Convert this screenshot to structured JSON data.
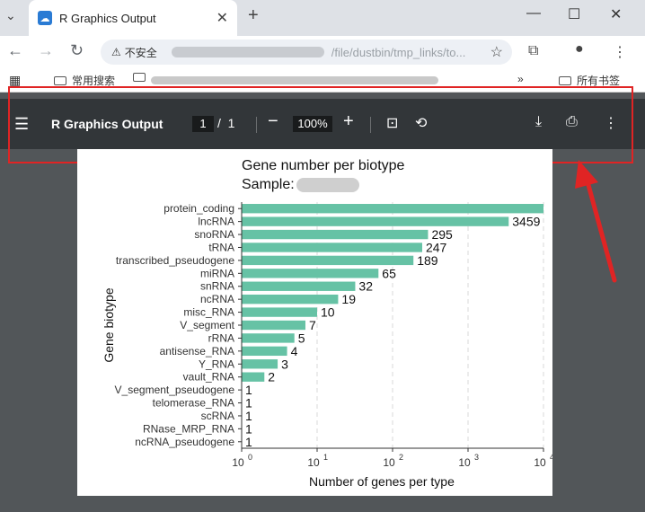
{
  "browser": {
    "tab_title": "R Graphics Output",
    "tab_close": "✕",
    "new_tab": "+",
    "tab_dropdown": "⌄",
    "minimize": "—",
    "maximize": "☐",
    "close": "✕",
    "insecure_label": "不安全",
    "url_visible": "/file/dustbin/tmp_links/to...",
    "bookmarks": [
      "常用搜索",
      "所有书签"
    ],
    "bookmarks_more": "»"
  },
  "pdf_toolbar": {
    "title": "R Graphics Output",
    "page_current": "1",
    "page_sep": "/",
    "page_total": "1",
    "zoom": "100%"
  },
  "colors": {
    "bar": "#66c2a5",
    "toolbar_bg": "#323639",
    "annotation": "#e02424"
  },
  "chart_data": {
    "type": "bar",
    "orientation": "horizontal",
    "title": "Gene number per biotype",
    "subtitle": "Sample:",
    "xlabel": "Number of genes per type",
    "ylabel": "Gene biotype",
    "x_scale": "log10",
    "xlim": [
      1,
      10000
    ],
    "x_ticks": [
      1,
      10,
      100,
      1000,
      10000
    ],
    "grid": "vertical dashed",
    "categories": [
      "protein_coding",
      "lncRNA",
      "snoRNA",
      "tRNA",
      "transcribed_pseudogene",
      "miRNA",
      "snRNA",
      "ncRNA",
      "misc_RNA",
      "V_segment",
      "rRNA",
      "antisense_RNA",
      "Y_RNA",
      "vault_RNA",
      "V_segment_pseudogene",
      "telomerase_RNA",
      "scRNA",
      "RNase_MRP_RNA",
      "ncRNA_pseudogene"
    ],
    "values": [
      10000,
      3459,
      295,
      247,
      189,
      65,
      32,
      19,
      10,
      7,
      5,
      4,
      3,
      2,
      1,
      1,
      1,
      1,
      1
    ],
    "value_labels": [
      "",
      "3459",
      "295",
      "247",
      "189",
      "65",
      "32",
      "19",
      "10",
      "7",
      "5",
      "4",
      "3",
      "2",
      "1",
      "1",
      "1",
      "1",
      "1"
    ]
  }
}
